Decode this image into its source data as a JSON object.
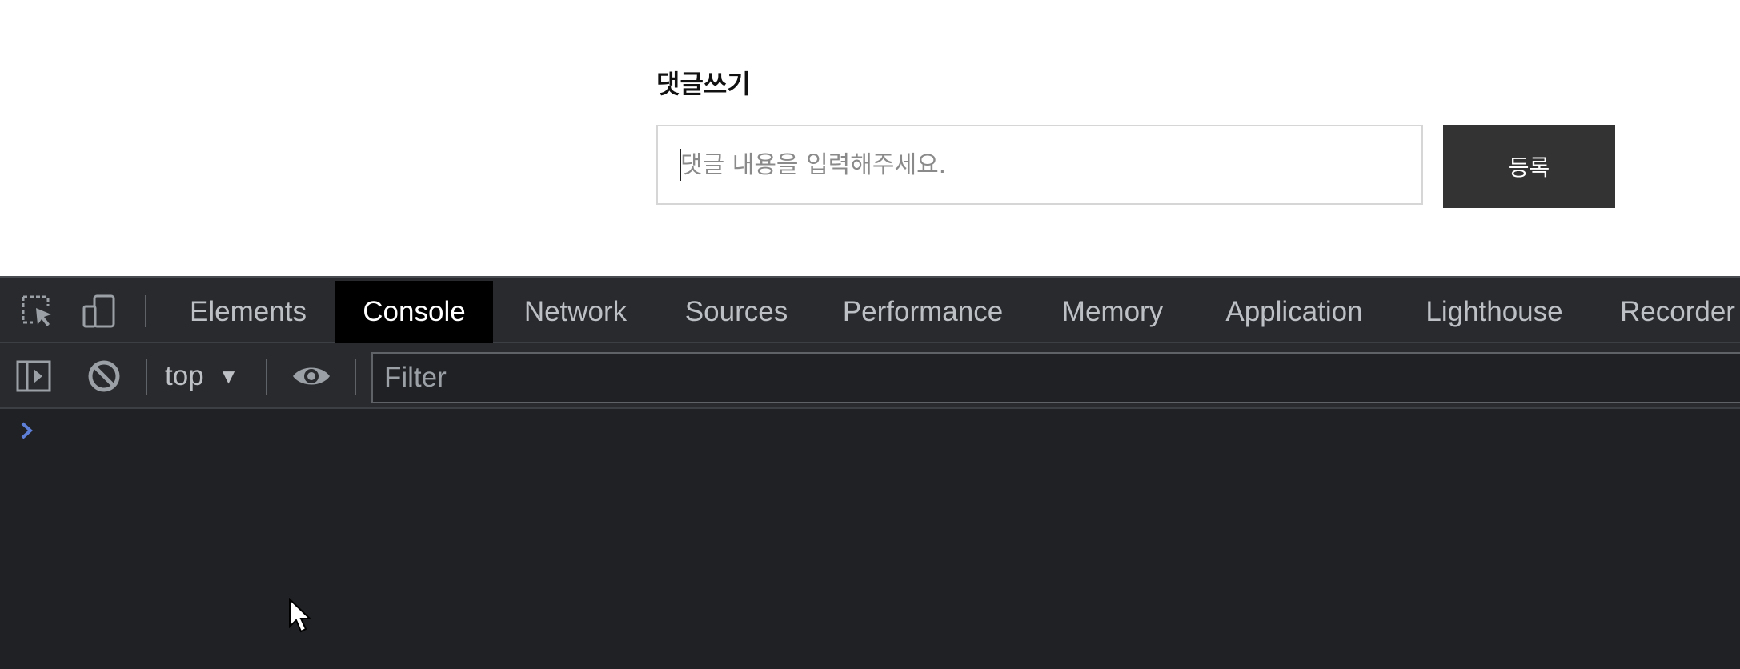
{
  "page": {
    "comment_title": "댓글쓰기",
    "comment_placeholder": "댓글 내용을 입력해주세요.",
    "submit_label": "등록"
  },
  "devtools": {
    "tabs": [
      {
        "label": "Elements",
        "active": false
      },
      {
        "label": "Console",
        "active": true
      },
      {
        "label": "Network",
        "active": false
      },
      {
        "label": "Sources",
        "active": false
      },
      {
        "label": "Performance",
        "active": false
      },
      {
        "label": "Memory",
        "active": false
      },
      {
        "label": "Application",
        "active": false
      },
      {
        "label": "Lighthouse",
        "active": false
      },
      {
        "label": "Recorder",
        "active": false
      }
    ],
    "toolbar": {
      "context": "top",
      "filter_placeholder": "Filter"
    },
    "icons": {
      "inspect": "inspect-element-icon",
      "device": "device-toolbar-icon",
      "sidebar": "show-sidebar-icon",
      "clear": "clear-console-icon",
      "dropdown": "dropdown-arrow-icon",
      "live_expression": "eye-icon",
      "prompt": "prompt-chevron-icon",
      "cursor": "mouse-pointer-icon"
    },
    "colors": {
      "background": "#202124",
      "active_tab": "#000000",
      "prompt": "#5e7fd8"
    }
  }
}
